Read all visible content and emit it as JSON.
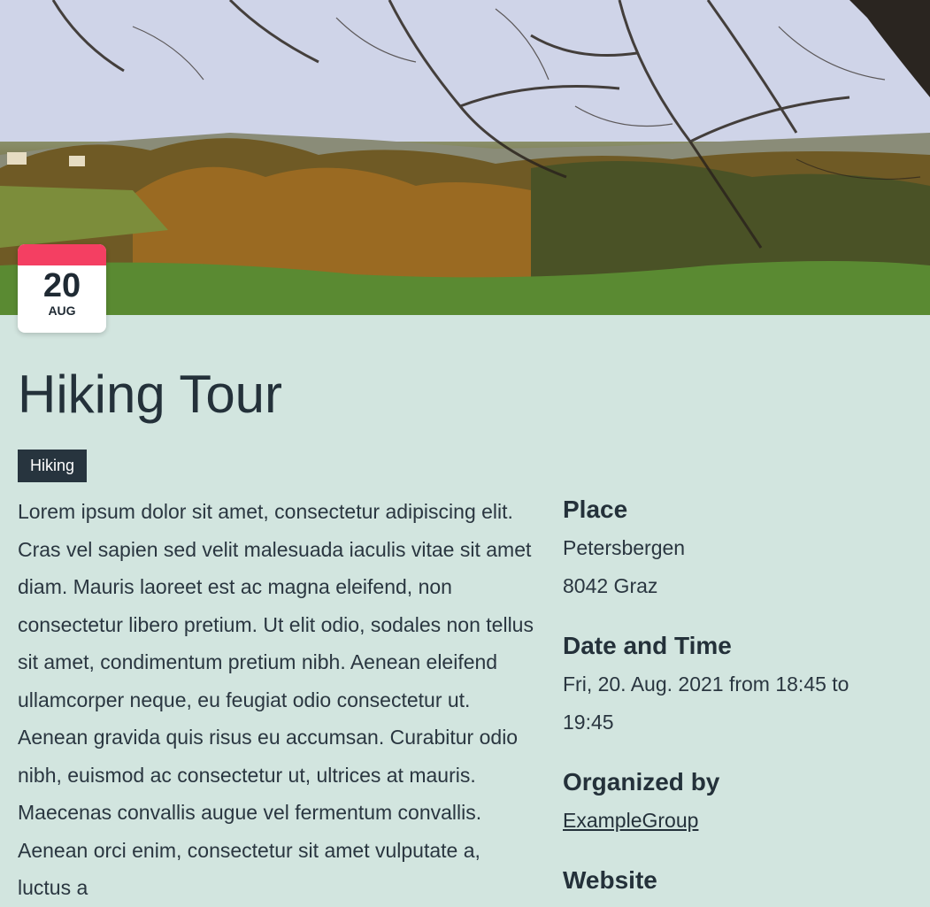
{
  "event": {
    "day": "20",
    "month": "AUG",
    "title": "Hiking Tour",
    "tag": "Hiking",
    "description": "Lorem ipsum dolor sit amet, consectetur adipiscing elit. Cras vel sapien sed velit malesuada iaculis vitae sit amet diam. Mauris laoreet est ac magna eleifend, non consectetur libero pretium. Ut elit odio, sodales non tellus sit amet, condimentum pretium nibh. Aenean eleifend ullamcorper neque, eu feugiat odio consectetur ut. Aenean gravida quis risus eu accumsan. Curabitur odio nibh, euismod ac consectetur ut, ultrices at mauris. Maecenas convallis augue vel fermentum convallis. Aenean orci enim, consectetur sit amet vulputate a, luctus a"
  },
  "details": {
    "place_heading": "Place",
    "place_line1": "Petersbergen",
    "place_line2": "8042 Graz",
    "datetime_heading": "Date and Time",
    "datetime_value": "Fri, 20. Aug. 2021 from 18:45 to 19:45",
    "organizer_heading": "Organized by",
    "organizer_link": "ExampleGroup",
    "website_heading": "Website"
  },
  "colors": {
    "background": "#d2e5df",
    "badge_accent": "#f43f62",
    "tag_background": "#27343e",
    "text": "#24313a"
  }
}
